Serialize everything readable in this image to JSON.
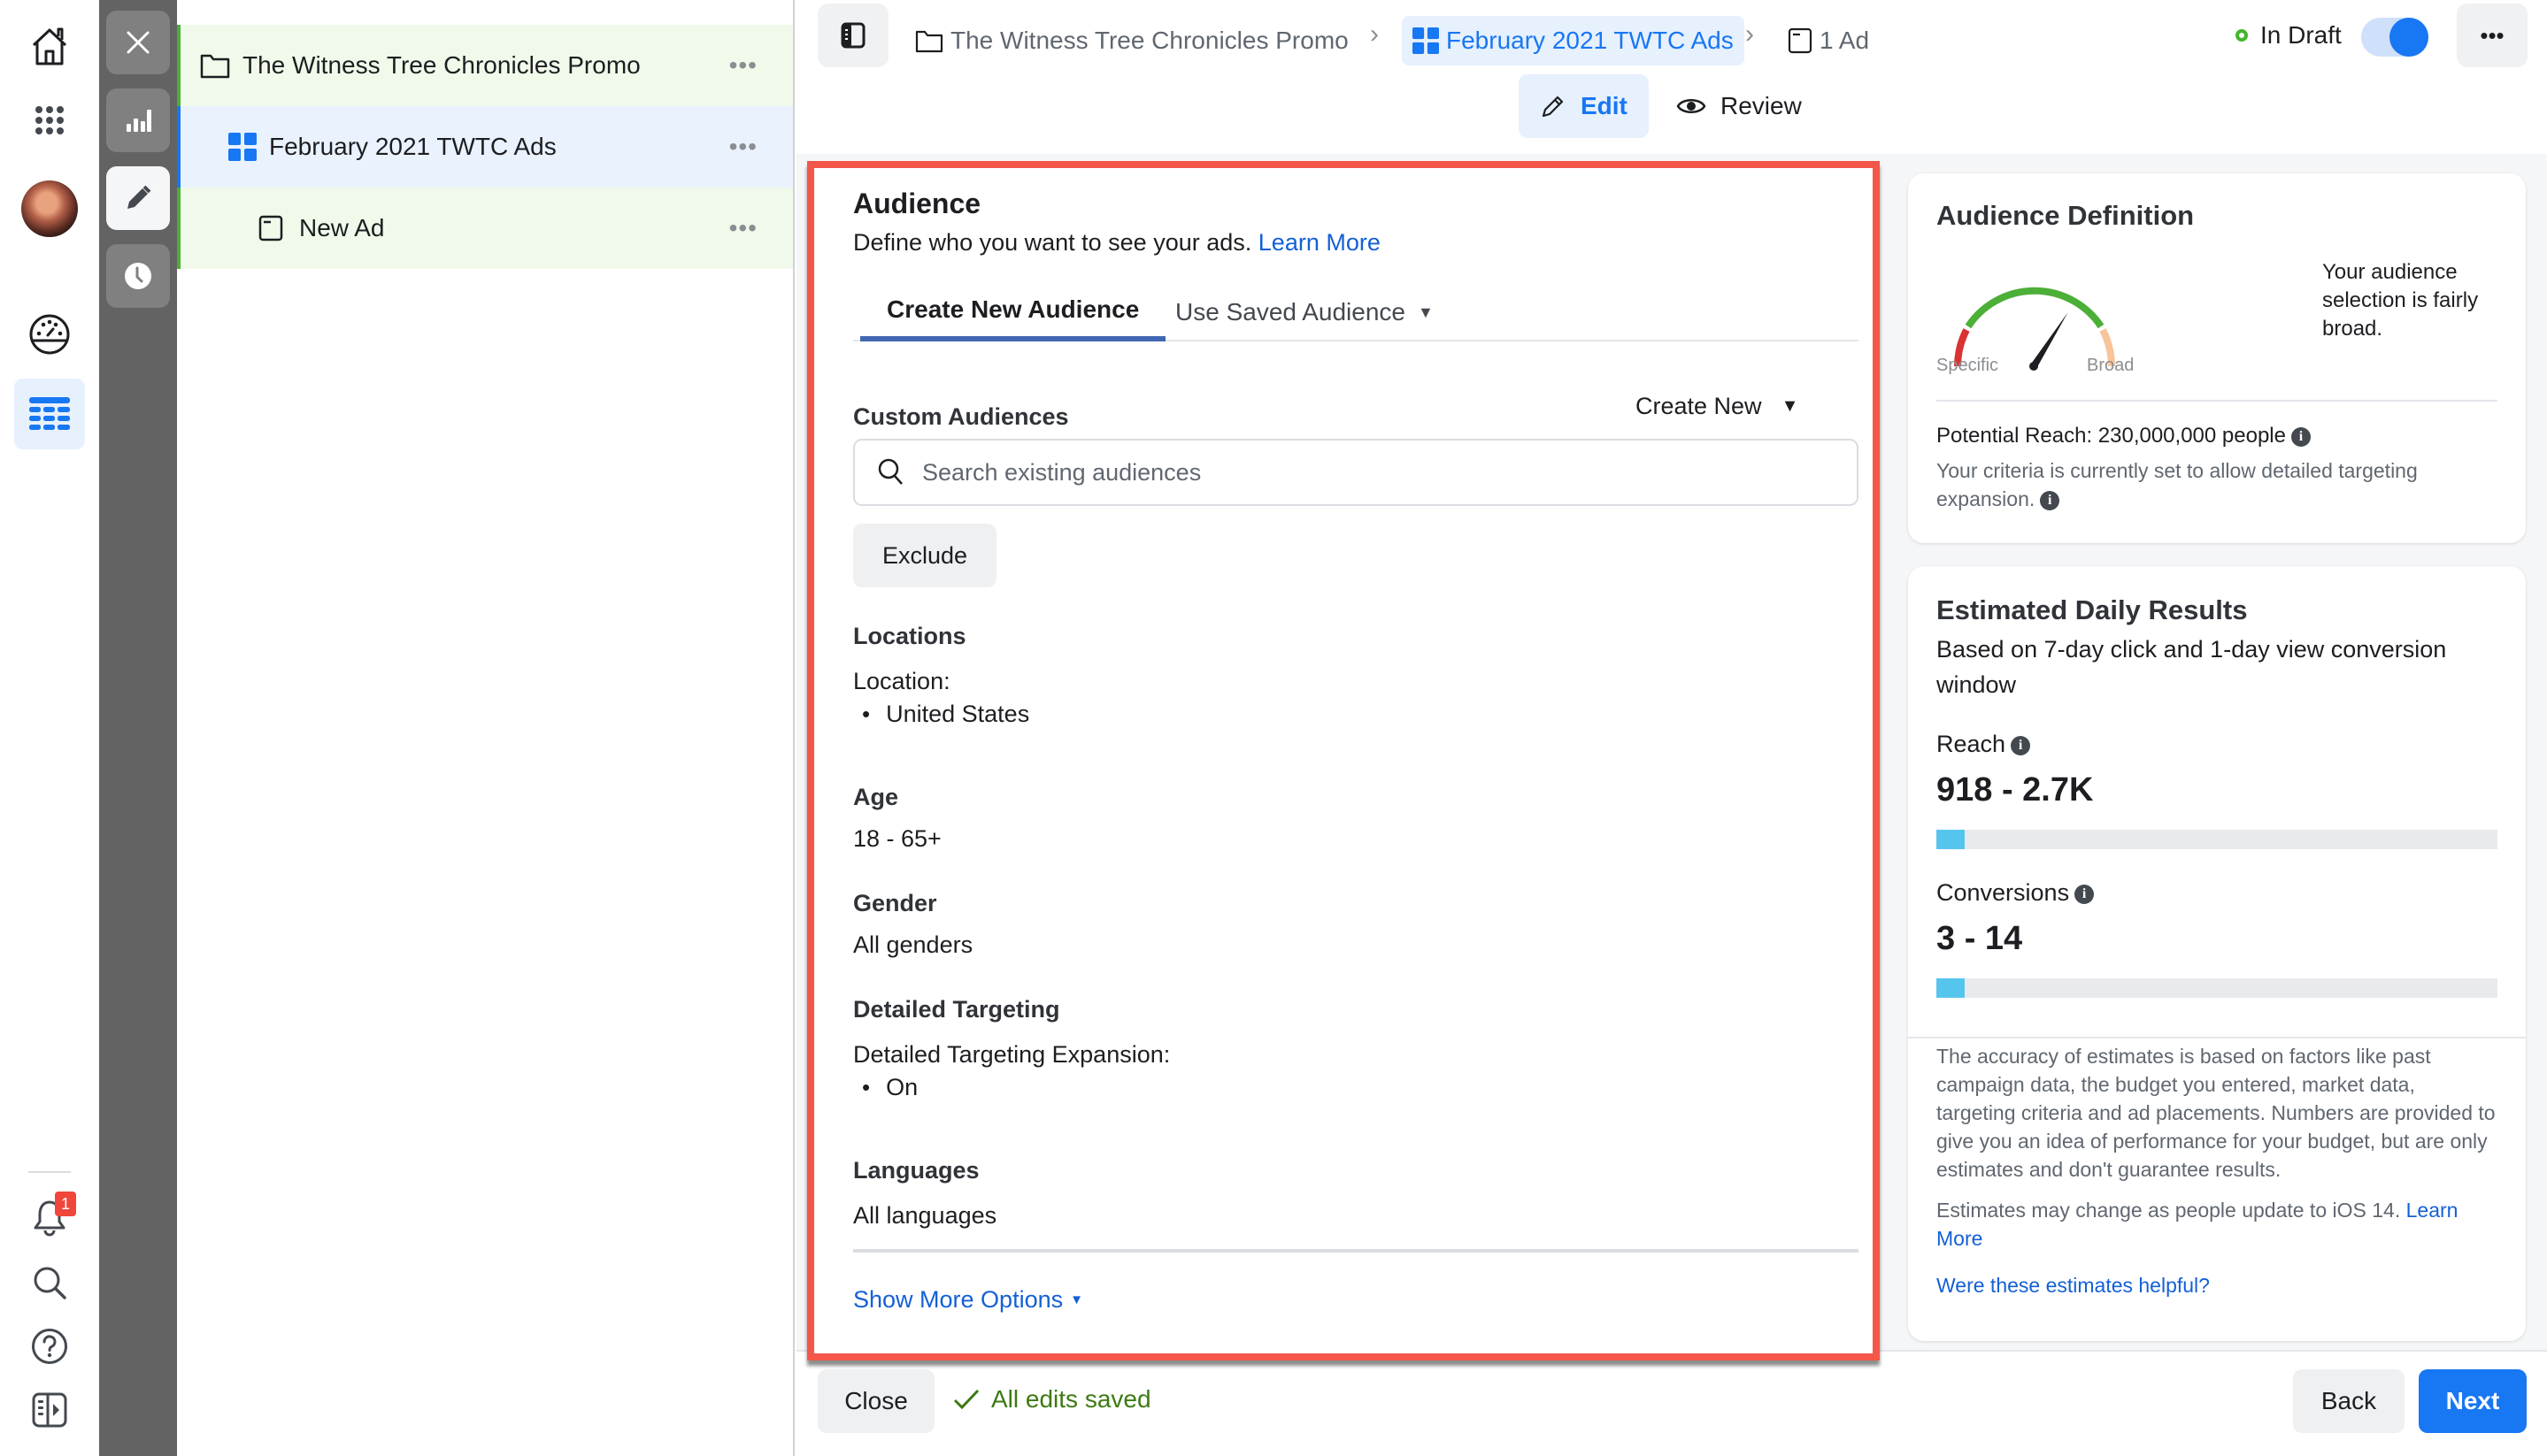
{
  "rail": {
    "icons": [
      "home-icon",
      "apps-grid-icon",
      "avatar",
      "performance-gauge-icon",
      "ads-manager-table-icon",
      "notifications-bell-icon",
      "search-icon",
      "help-icon",
      "collapse-panel-icon"
    ],
    "notification_count": "1"
  },
  "strip": {
    "buttons": [
      "close-icon",
      "charts-icon",
      "edit-pencil-icon",
      "history-clock-icon"
    ],
    "active": "edit-pencil-icon"
  },
  "tree": {
    "items": [
      {
        "label": "The Witness Tree Chronicles Promo",
        "type": "campaign"
      },
      {
        "label": "February 2021 TWTC Ads",
        "type": "ad-set"
      },
      {
        "label": "New Ad",
        "type": "ad"
      }
    ],
    "more_label": "•••"
  },
  "topbar": {
    "breadcrumb": [
      {
        "label": "The Witness Tree Chronicles Promo"
      },
      {
        "label": "February 2021 TWTC Ads"
      },
      {
        "label": "1 Ad"
      }
    ],
    "status_label": "In Draft",
    "toggle_on": true,
    "more_label": "•••",
    "edit_label": "Edit",
    "review_label": "Review"
  },
  "audience": {
    "title": "Audience",
    "subtitle": "Define who you want to see your ads.",
    "learn_more": "Learn More",
    "tabs": [
      {
        "label": "Create New Audience",
        "active": true
      },
      {
        "label": "Use Saved Audience",
        "active": false
      }
    ],
    "custom_audiences": {
      "label": "Custom Audiences",
      "create_new": "Create New",
      "search_placeholder": "Search existing audiences",
      "exclude_label": "Exclude"
    },
    "locations": {
      "label": "Locations",
      "sub_label": "Location:",
      "values": [
        "United States"
      ]
    },
    "age": {
      "label": "Age",
      "value": "18 - 65+"
    },
    "gender": {
      "label": "Gender",
      "value": "All genders"
    },
    "detailed_targeting": {
      "label": "Detailed Targeting",
      "sub_label": "Detailed Targeting Expansion:",
      "values": [
        "On"
      ]
    },
    "languages": {
      "label": "Languages",
      "value": "All languages"
    },
    "show_more": "Show More Options"
  },
  "audience_definition": {
    "title": "Audience Definition",
    "gauge_specific": "Specific",
    "gauge_broad": "Broad",
    "gauge_level": 0.68,
    "description": "Your audience selection is fairly broad.",
    "potential_reach": "Potential Reach: 230,000,000 people",
    "expansion_note": "Your criteria is currently set to allow detailed targeting expansion."
  },
  "estimated_daily": {
    "title": "Estimated Daily Results",
    "subtitle": "Based on 7-day click and 1-day view conversion window",
    "reach_label": "Reach",
    "reach_value": "918 - 2.7K",
    "reach_fill": 0.05,
    "conversions_label": "Conversions",
    "conversions_value": "3 - 14",
    "conversions_fill": 0.05,
    "accuracy_note": "The accuracy of estimates is based on factors like past campaign data, the budget you entered, market data, targeting criteria and ad placements. Numbers are provided to give you an idea of performance for your budget, but are only estimates and don't guarantee results.",
    "ios_note": "Estimates may change as people update to iOS 14.",
    "learn_more": "Learn More",
    "helpful_link": "Were these estimates helpful?"
  },
  "footer": {
    "close_label": "Close",
    "saved_label": "All edits saved",
    "back_label": "Back",
    "next_label": "Next"
  },
  "colors": {
    "accent": "#1877f2",
    "highlight_border": "#f4564a",
    "status_green": "#42b72a",
    "progress_fill": "#56c5ee"
  }
}
